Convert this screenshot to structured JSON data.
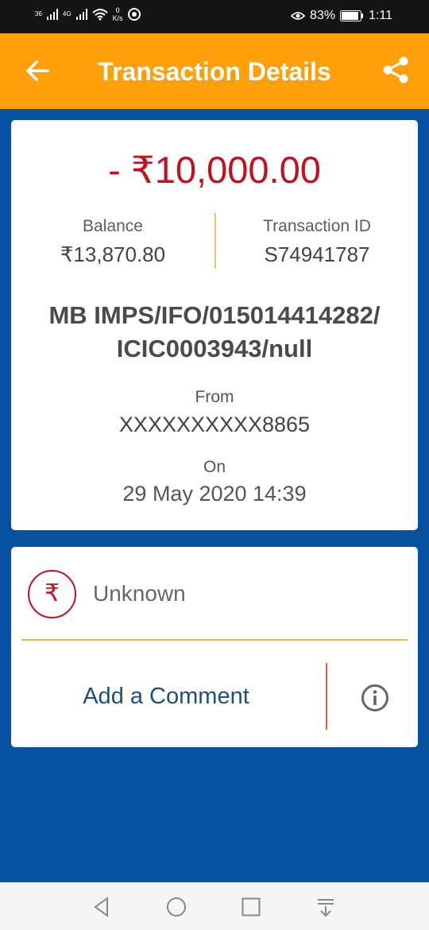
{
  "status_bar": {
    "network1": "36",
    "network2": "4G",
    "speed_value": "0",
    "speed_unit": "K/s",
    "battery": "83%",
    "time": "1:11"
  },
  "app_bar": {
    "title": "Transaction Details",
    "back_icon": "arrow-left-icon",
    "share_icon": "share-icon"
  },
  "transaction": {
    "amount": "- ₹10,000.00",
    "balance_label": "Balance",
    "balance_value": "₹13,870.80",
    "txn_id_label": "Transaction ID",
    "txn_id_value": "S74941787",
    "narration_line1": "MB IMPS/IFO/015014414282/",
    "narration_line2": "ICIC0003943/null",
    "from_label": "From",
    "from_value": "XXXXXXXXXX8865",
    "on_label": "On",
    "on_value": "29 May 2020 14:39"
  },
  "category": {
    "icon": "₹",
    "label": "Unknown"
  },
  "comment": {
    "label": "Add a Comment",
    "info_icon": "info-icon"
  },
  "nav_bar": {
    "icons": [
      "back-triangle-icon",
      "home-circle-icon",
      "recents-square-icon",
      "notification-pull-icon"
    ]
  },
  "colors": {
    "app_bar": "#ff9f0a",
    "background": "#0651a0",
    "amount": "#c1121f"
  }
}
